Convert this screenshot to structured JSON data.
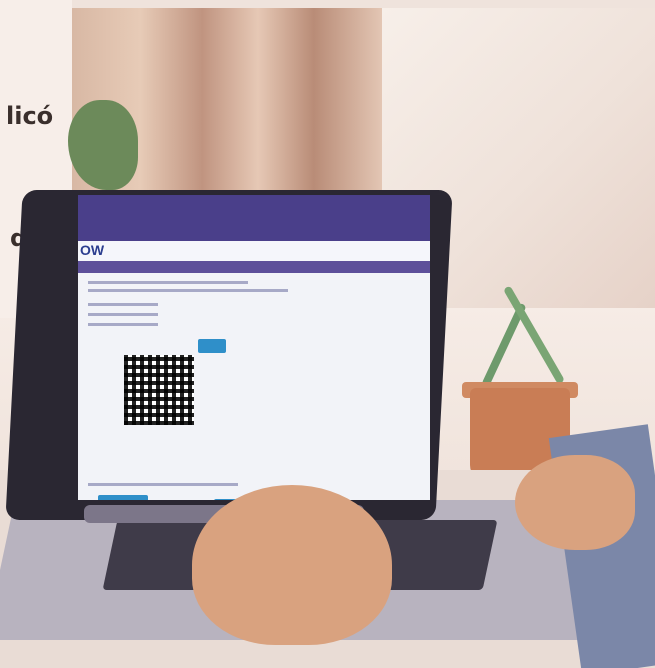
{
  "page": {
    "text_fragments": [
      {
        "label": "licó"
      },
      {
        "label": "de"
      }
    ],
    "screen": {
      "logo_text": "OW"
    }
  }
}
